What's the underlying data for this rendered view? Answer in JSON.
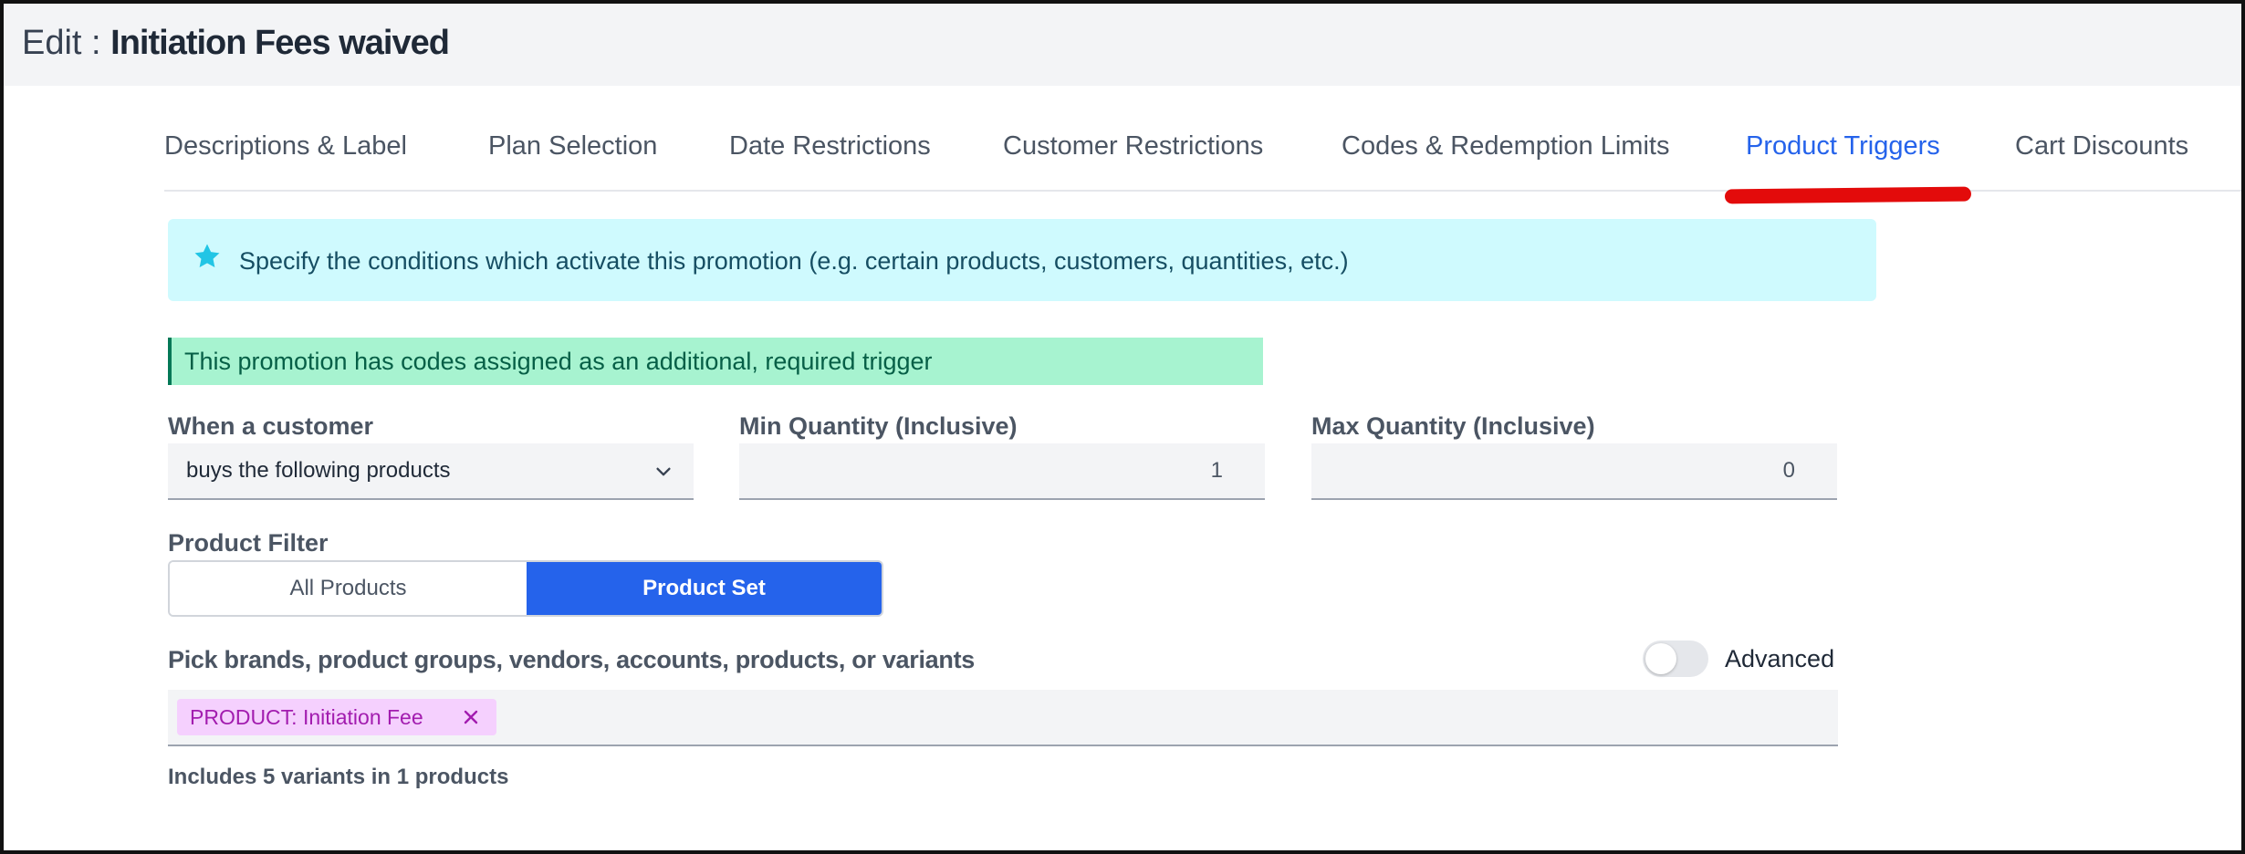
{
  "header": {
    "prefix": "Edit : ",
    "name": "Initiation Fees waived"
  },
  "tabs": [
    {
      "label": "Descriptions & Label",
      "active": false
    },
    {
      "label": "Plan Selection",
      "active": false
    },
    {
      "label": "Date Restrictions",
      "active": false
    },
    {
      "label": "Customer Restrictions",
      "active": false
    },
    {
      "label": "Codes & Redemption Limits",
      "active": false
    },
    {
      "label": "Product Triggers",
      "active": true
    },
    {
      "label": "Cart Discounts",
      "active": false
    }
  ],
  "info": {
    "icon": "star-icon",
    "text": "Specify the conditions which activate this promotion (e.g. certain products, customers, quantities, etc.)"
  },
  "notice": {
    "text": "This promotion has codes assigned as an additional, required trigger"
  },
  "fields": {
    "when_label": "When a customer",
    "when_value": "buys the following products",
    "min_label": "Min Quantity (Inclusive)",
    "min_value": "1",
    "max_label": "Max Quantity (Inclusive)",
    "max_value": "0"
  },
  "product_filter": {
    "label": "Product Filter",
    "options": [
      "All Products",
      "Product Set"
    ],
    "selected": "Product Set"
  },
  "picker": {
    "label": "Pick brands, product groups, vendors, accounts, products, or variants",
    "advanced_label": "Advanced",
    "advanced_on": false,
    "chip": "PRODUCT: Initiation Fee",
    "summary": "Includes 5 variants in 1 products"
  },
  "colors": {
    "accent": "#2563eb",
    "annotation": "#e30b0b",
    "info_bg": "#cffafe",
    "notice_bg": "#a7f3d0",
    "chip_bg": "#f5d0fe"
  }
}
